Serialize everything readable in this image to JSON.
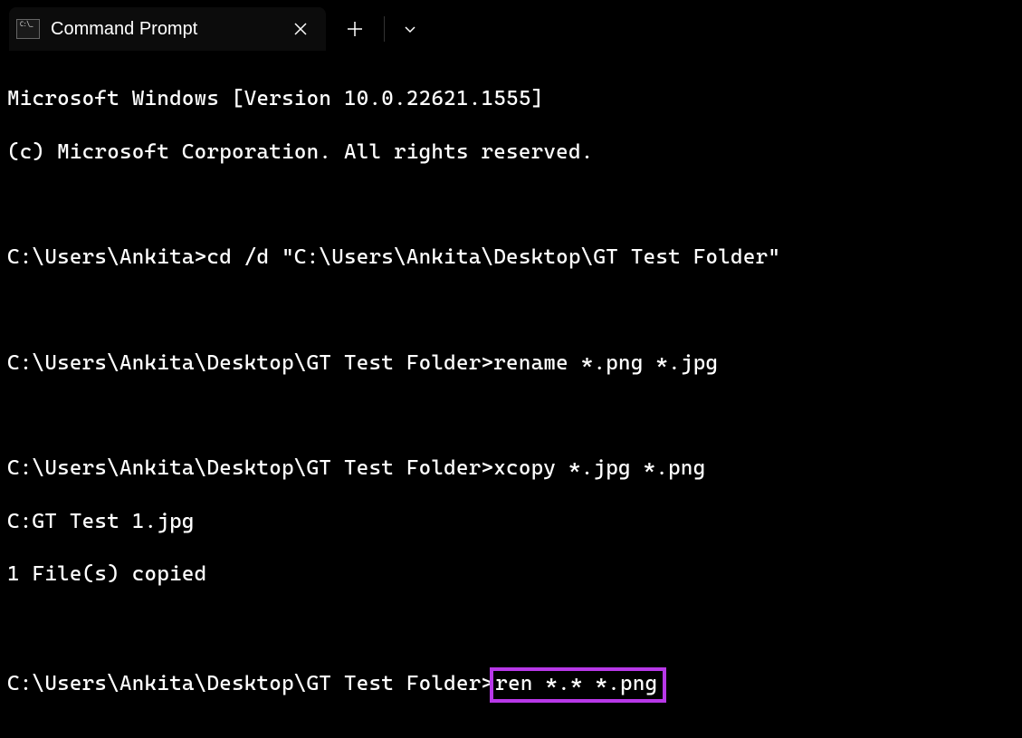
{
  "tab": {
    "title": "Command Prompt"
  },
  "terminal": {
    "lines": [
      "Microsoft Windows [Version 10.0.22621.1555]",
      "(c) Microsoft Corporation. All rights reserved.",
      "",
      "C:\\Users\\Ankita>cd /d \"C:\\Users\\Ankita\\Desktop\\GT Test Folder\"",
      "",
      "C:\\Users\\Ankita\\Desktop\\GT Test Folder>rename *.png *.jpg",
      "",
      "C:\\Users\\Ankita\\Desktop\\GT Test Folder>xcopy *.jpg *.png",
      "C:GT Test 1.jpg",
      "1 File(s) copied",
      ""
    ],
    "last_prompt": "C:\\Users\\Ankita\\Desktop\\GT Test Folder>",
    "highlighted_command": "ren *.* *.png"
  }
}
